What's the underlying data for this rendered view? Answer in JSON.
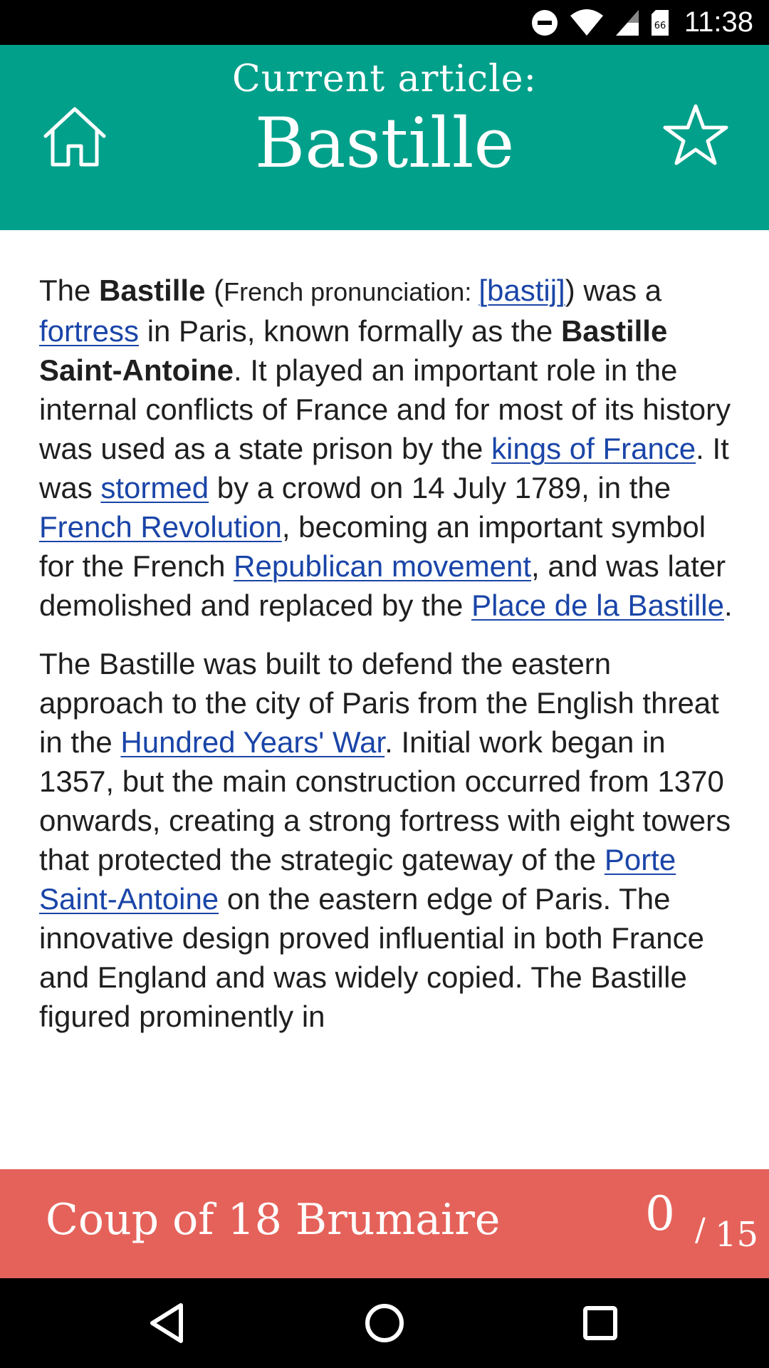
{
  "status_bar": {
    "time": "11:38",
    "icons": [
      "do-not-disturb-icon",
      "wifi-icon",
      "cell-signal-icon",
      "sim-card-icon"
    ]
  },
  "header": {
    "subtitle": "Current article:",
    "title": "Bastille",
    "background_color": "#00a08a",
    "home_icon": "home-icon",
    "favorite_icon": "star-icon"
  },
  "article": {
    "p1": {
      "t1": "The ",
      "b1": "Bastille",
      "t2": " (",
      "pron_label": "French pronunciation: ",
      "pron_link": "[bastij]",
      "t3": ") was a ",
      "link_fortress": "fortress",
      "t4": " in Paris, known formally as the ",
      "b2": "Bastille Saint-Antoine",
      "t5": ". It played an important role in the internal conflicts of France and for most of its history was used as a state prison by the ",
      "link_kings": "kings of France",
      "t6": ". It was ",
      "link_stormed": "stormed",
      "t7": " by a crowd on 14 July 1789, in the ",
      "link_revolution": "French Revolution",
      "t8": ", becoming an important symbol for the French ",
      "link_republican": "Republican movement",
      "t9": ", and was later demolished and replaced by the ",
      "link_place": "Place de la Bastille",
      "t10": "."
    },
    "p2": {
      "t1": "The Bastille was built to defend the eastern approach to the city of Paris from the English threat in the ",
      "link_war": "Hundred Years' War",
      "t2": ". Initial work began in 1357, but the main construction occurred from 1370 onwards, creating a strong fortress with eight towers that protected the strategic gateway of the ",
      "link_porte": "Porte Saint-Antoine",
      "t3": " on the eastern edge of Paris. The innovative design proved influential in both France and England and was widely copied. The Bastille figured prominently in"
    },
    "link_color": "#1a45a8"
  },
  "footer": {
    "target_article": "Coup of 18 Brumaire",
    "clicks": "0",
    "separator": "/",
    "max_clicks": "15",
    "background_color": "#e5625a"
  },
  "nav_bar": {
    "icons": [
      "back-icon",
      "home-circle-icon",
      "recents-icon"
    ]
  }
}
